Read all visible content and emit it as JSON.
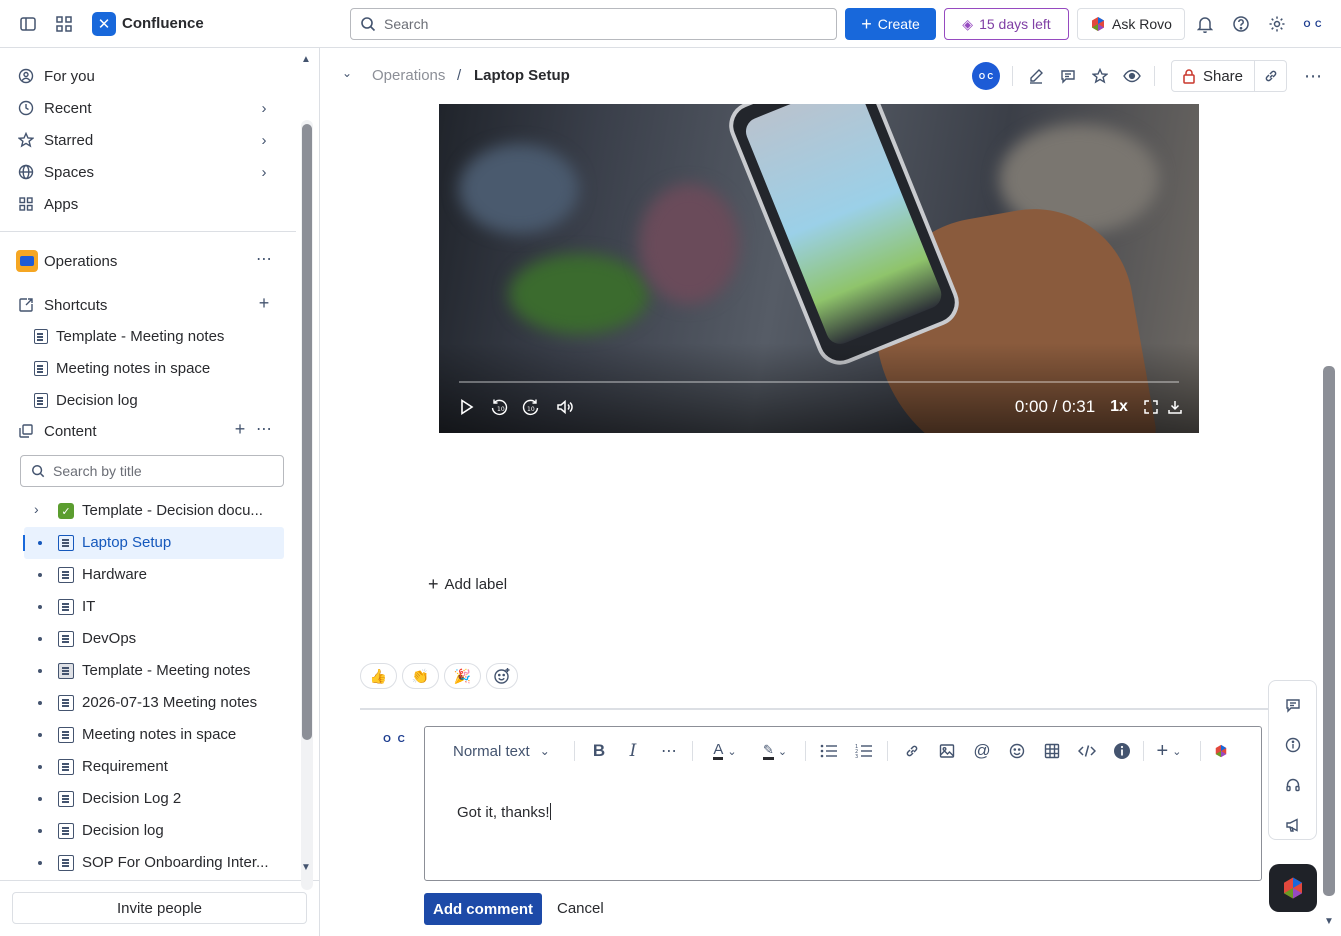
{
  "topbar": {
    "app_name": "Confluence",
    "search_placeholder": "Search",
    "create_label": "Create",
    "trial_label": "15 days left",
    "rovo_label": "Ask Rovo",
    "profile_initials": "O C"
  },
  "sidebar": {
    "nav": [
      {
        "label": "For you"
      },
      {
        "label": "Recent"
      },
      {
        "label": "Starred"
      },
      {
        "label": "Spaces"
      },
      {
        "label": "Apps"
      }
    ],
    "space_name": "Operations",
    "shortcuts_label": "Shortcuts",
    "shortcuts": [
      {
        "label": "Template - Meeting notes"
      },
      {
        "label": "Meeting notes in space"
      },
      {
        "label": "Decision log"
      }
    ],
    "content_label": "Content",
    "filter_placeholder": "Search by title",
    "tree": [
      {
        "label": "Template - Decision docu..."
      },
      {
        "label": "Laptop Setup"
      },
      {
        "label": "Hardware"
      },
      {
        "label": "IT"
      },
      {
        "label": "DevOps"
      },
      {
        "label": "Template - Meeting notes"
      },
      {
        "label": "2026-07-13 Meeting notes"
      },
      {
        "label": "Meeting notes in space"
      },
      {
        "label": "Requirement"
      },
      {
        "label": "Decision Log 2"
      },
      {
        "label": "Decision log"
      },
      {
        "label": "SOP For Onboarding Inter..."
      }
    ],
    "invite_label": "Invite people"
  },
  "page": {
    "breadcrumb_parent": "Operations",
    "breadcrumb_sep": "/",
    "title": "Laptop Setup",
    "avatar_initials": "O C",
    "share_label": "Share",
    "video": {
      "time": "0:00 / 0:31",
      "speed": "1x",
      "progress": 0
    },
    "add_label": "Add label",
    "reactions": [
      "👍",
      "👏",
      "🎉"
    ]
  },
  "comment": {
    "author_initials": "O C",
    "text_style": "Normal text",
    "text": "Got it, thanks!",
    "submit_label": "Add comment",
    "cancel_label": "Cancel"
  },
  "colors": {
    "brand": "#1868db",
    "selected_bg": "#e9f2fe",
    "trial": "#803fa5",
    "submit": "#1d4aa8"
  }
}
